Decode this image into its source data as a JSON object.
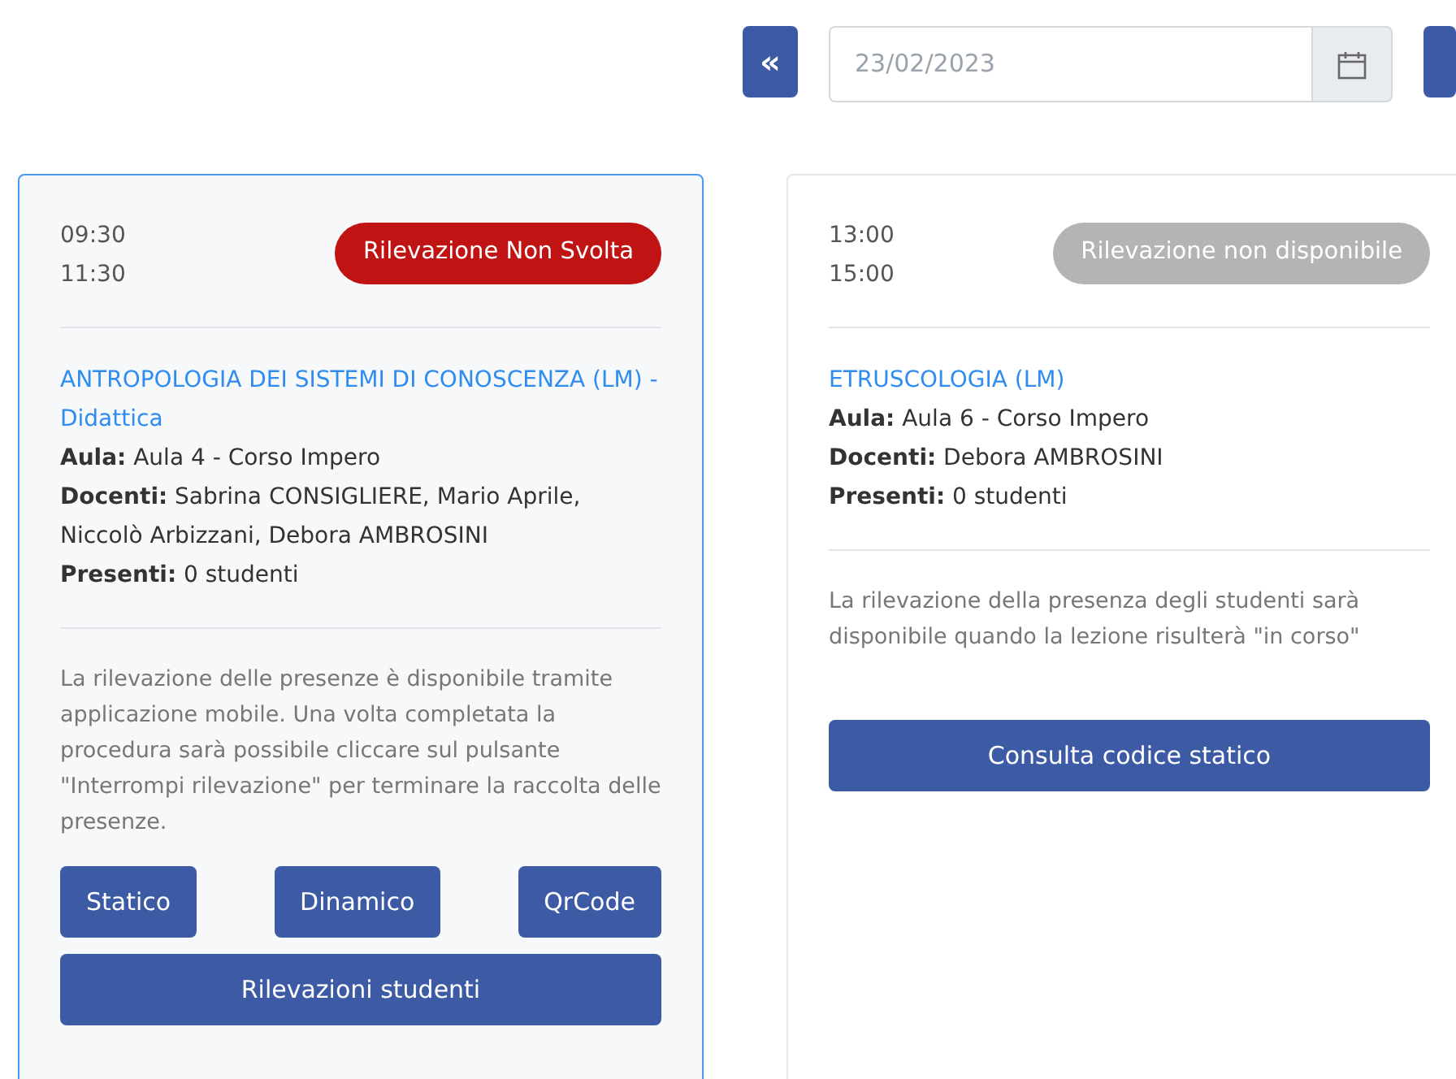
{
  "toolbar": {
    "prev_button": "«",
    "date": {
      "placeholder": "23/02/2023"
    }
  },
  "lessons": [
    {
      "selected": true,
      "start": "09:30",
      "end": "11:30",
      "status": {
        "kind": "not-done",
        "label": "Rilevazione Non Svolta"
      },
      "title": "ANTROPOLOGIA DEI SISTEMI DI CONOSCENZA (LM) - Didattica",
      "fields": [
        {
          "label": "Aula:",
          "value": "Aula 4 - Corso Impero"
        },
        {
          "label": "Docenti:",
          "value": "Sabrina CONSIGLIERE, Mario Aprile, Niccolò Arbizzani, Debora AMBROSINI"
        },
        {
          "label": "Presenti:",
          "value": "0 studenti"
        }
      ],
      "note": "La rilevazione delle presenze è disponibile tramite applicazione mobile. Una volta completata la procedura sarà possibile cliccare sul pulsante \"Interrompi rilevazione\" per terminare la raccolta delle presenze.",
      "buttons": [
        {
          "label": "Statico",
          "kind": "small"
        },
        {
          "label": "Dinamico",
          "kind": "small"
        },
        {
          "label": "QrCode",
          "kind": "small"
        },
        {
          "label": "Rilevazioni studenti",
          "kind": "wide"
        }
      ]
    },
    {
      "selected": false,
      "start": "13:00",
      "end": "15:00",
      "status": {
        "kind": "unavailable",
        "label": "Rilevazione non disponibile"
      },
      "title": "ETRUSCOLOGIA (LM)",
      "fields": [
        {
          "label": "Aula:",
          "value": "Aula 6 - Corso Impero"
        },
        {
          "label": "Docenti:",
          "value": "Debora AMBROSINI"
        },
        {
          "label": "Presenti:",
          "value": "0 studenti"
        }
      ],
      "note": "La rilevazione della presenza degli studenti sarà disponibile quando la lezione risulterà \"in corso\"",
      "buttons": [
        {
          "label": "Consulta codice statico",
          "kind": "wide"
        }
      ]
    }
  ]
}
